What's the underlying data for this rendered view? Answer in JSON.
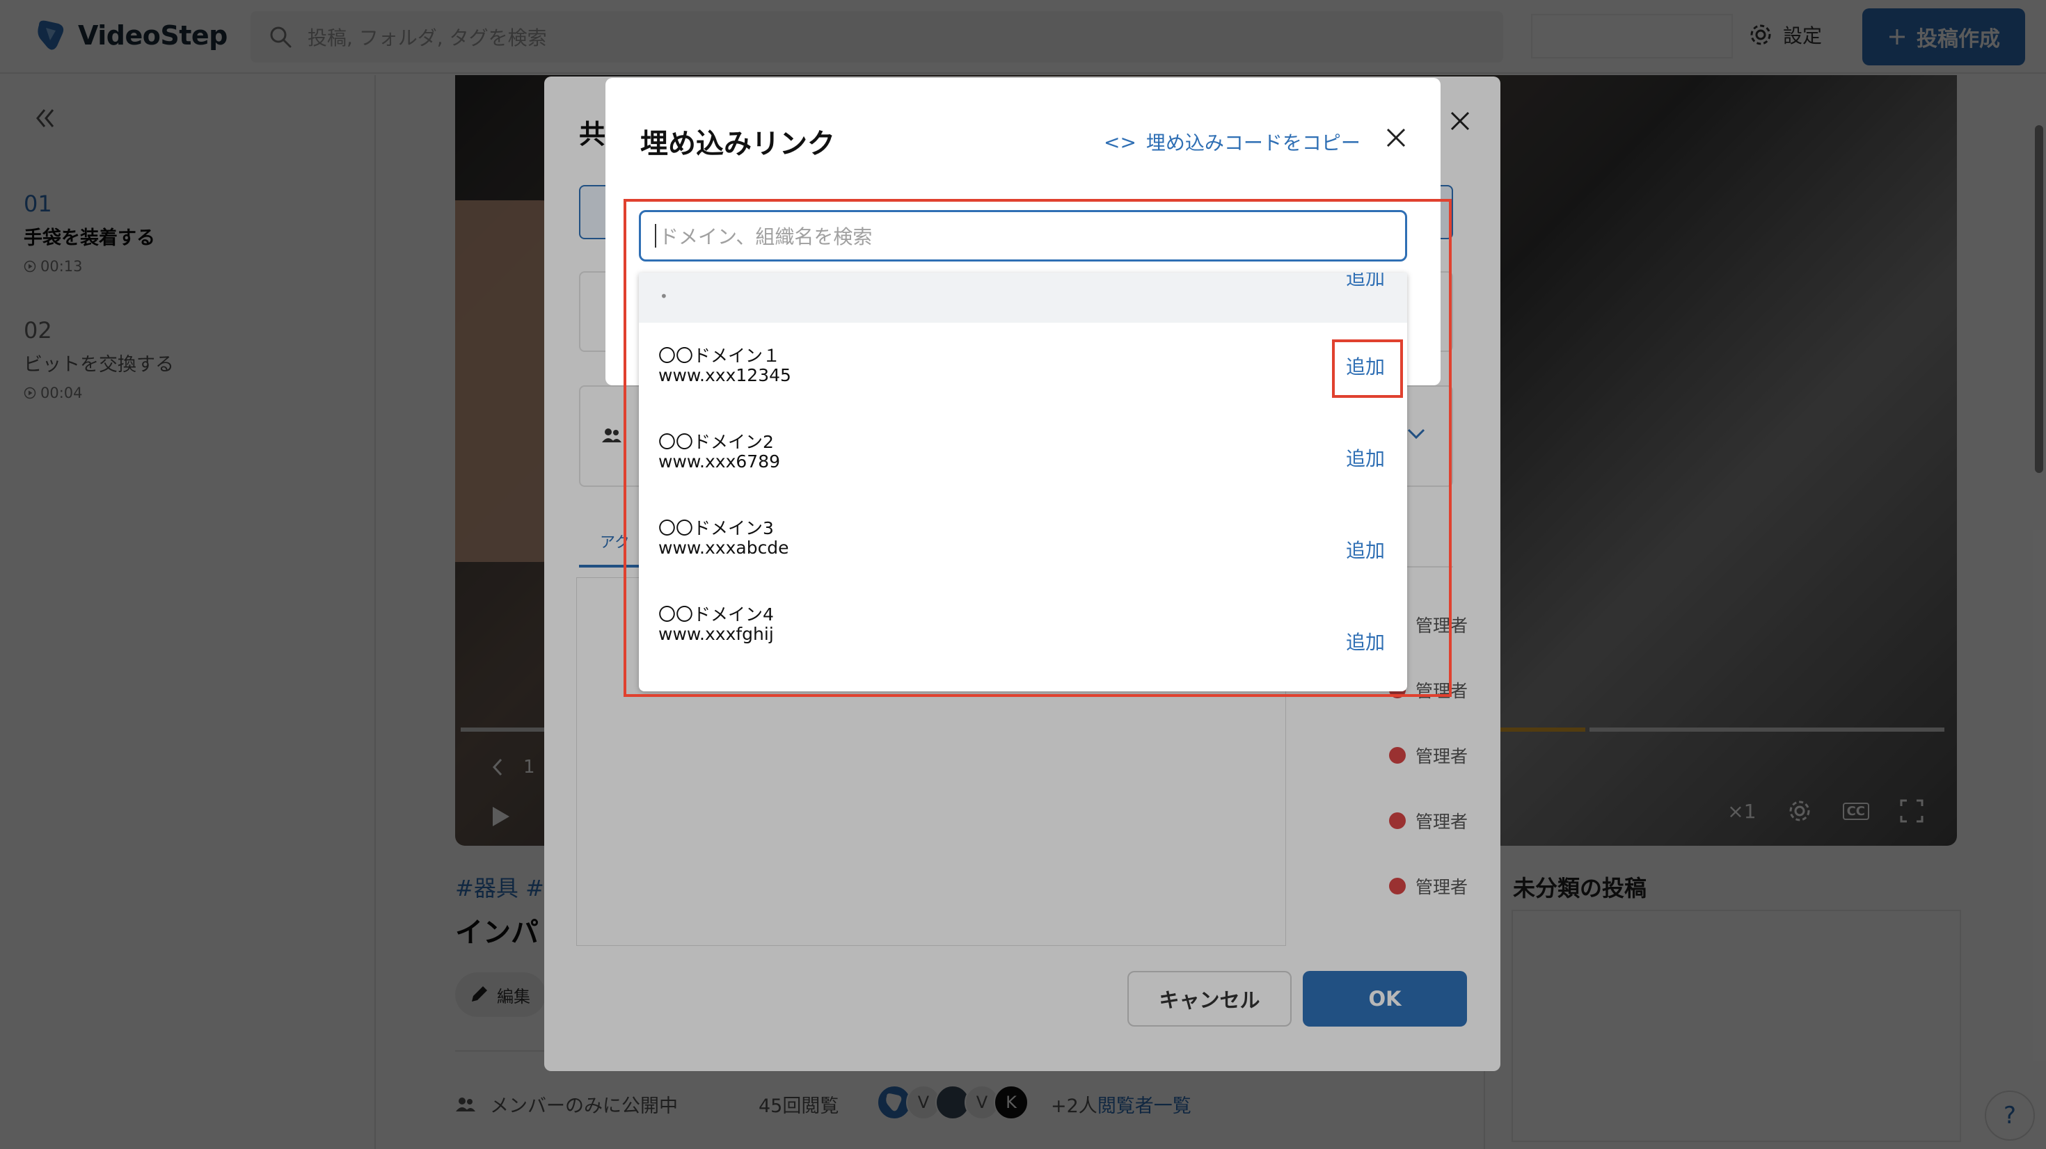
{
  "header": {
    "brand": "VideoStep",
    "search_placeholder": "投稿, フォルダ, タグを検索",
    "settings_label": "設定",
    "post_button_label": "投稿作成"
  },
  "sidebar": {
    "steps": [
      {
        "num": "01",
        "title": "手袋を装着する",
        "time": "00:13"
      },
      {
        "num": "02",
        "title": "ビットを交換する",
        "time": "00:04"
      }
    ]
  },
  "video": {
    "speed": "×1",
    "cc_label": "CC",
    "step_fragment": "1"
  },
  "main": {
    "tags": "#器具  #",
    "title_fragment": "インパ",
    "edit_label": "編集",
    "visibility": "メンバーのみに公開中",
    "views": "45回閲覧",
    "avatar_letters": [
      "V",
      "V",
      "K"
    ],
    "more_viewers": "+2人",
    "viewer_list_link": "閲覧者一覧"
  },
  "right": {
    "uncategorized_title": "未分類の投稿"
  },
  "share_modal": {
    "title_fragment": "共",
    "tab_fragment": "アク",
    "role_label": "管理者",
    "cancel_label": "キャンセル",
    "ok_label": "OK"
  },
  "embed_modal": {
    "title": "埋め込みリンク",
    "copy_code_label": "埋め込みコードをコピー",
    "copy_icon_text": "<>",
    "search_placeholder": "ドメイン、組織名を検索",
    "first_row_bullet": "•",
    "add_label": "追加",
    "domains": [
      {
        "name": "〇〇ドメイン１",
        "url": "www.xxx12345"
      },
      {
        "name": "〇〇ドメイン2",
        "url": "www.xxx6789"
      },
      {
        "name": "〇〇ドメイン3",
        "url": "www.xxxabcde"
      },
      {
        "name": "〇〇ドメイン4",
        "url": "www.xxxfghij"
      }
    ]
  },
  "help_label": "?",
  "colors": {
    "accent": "#2f6fb4",
    "highlight": "#e0412f",
    "status_dot": "#d64545"
  }
}
